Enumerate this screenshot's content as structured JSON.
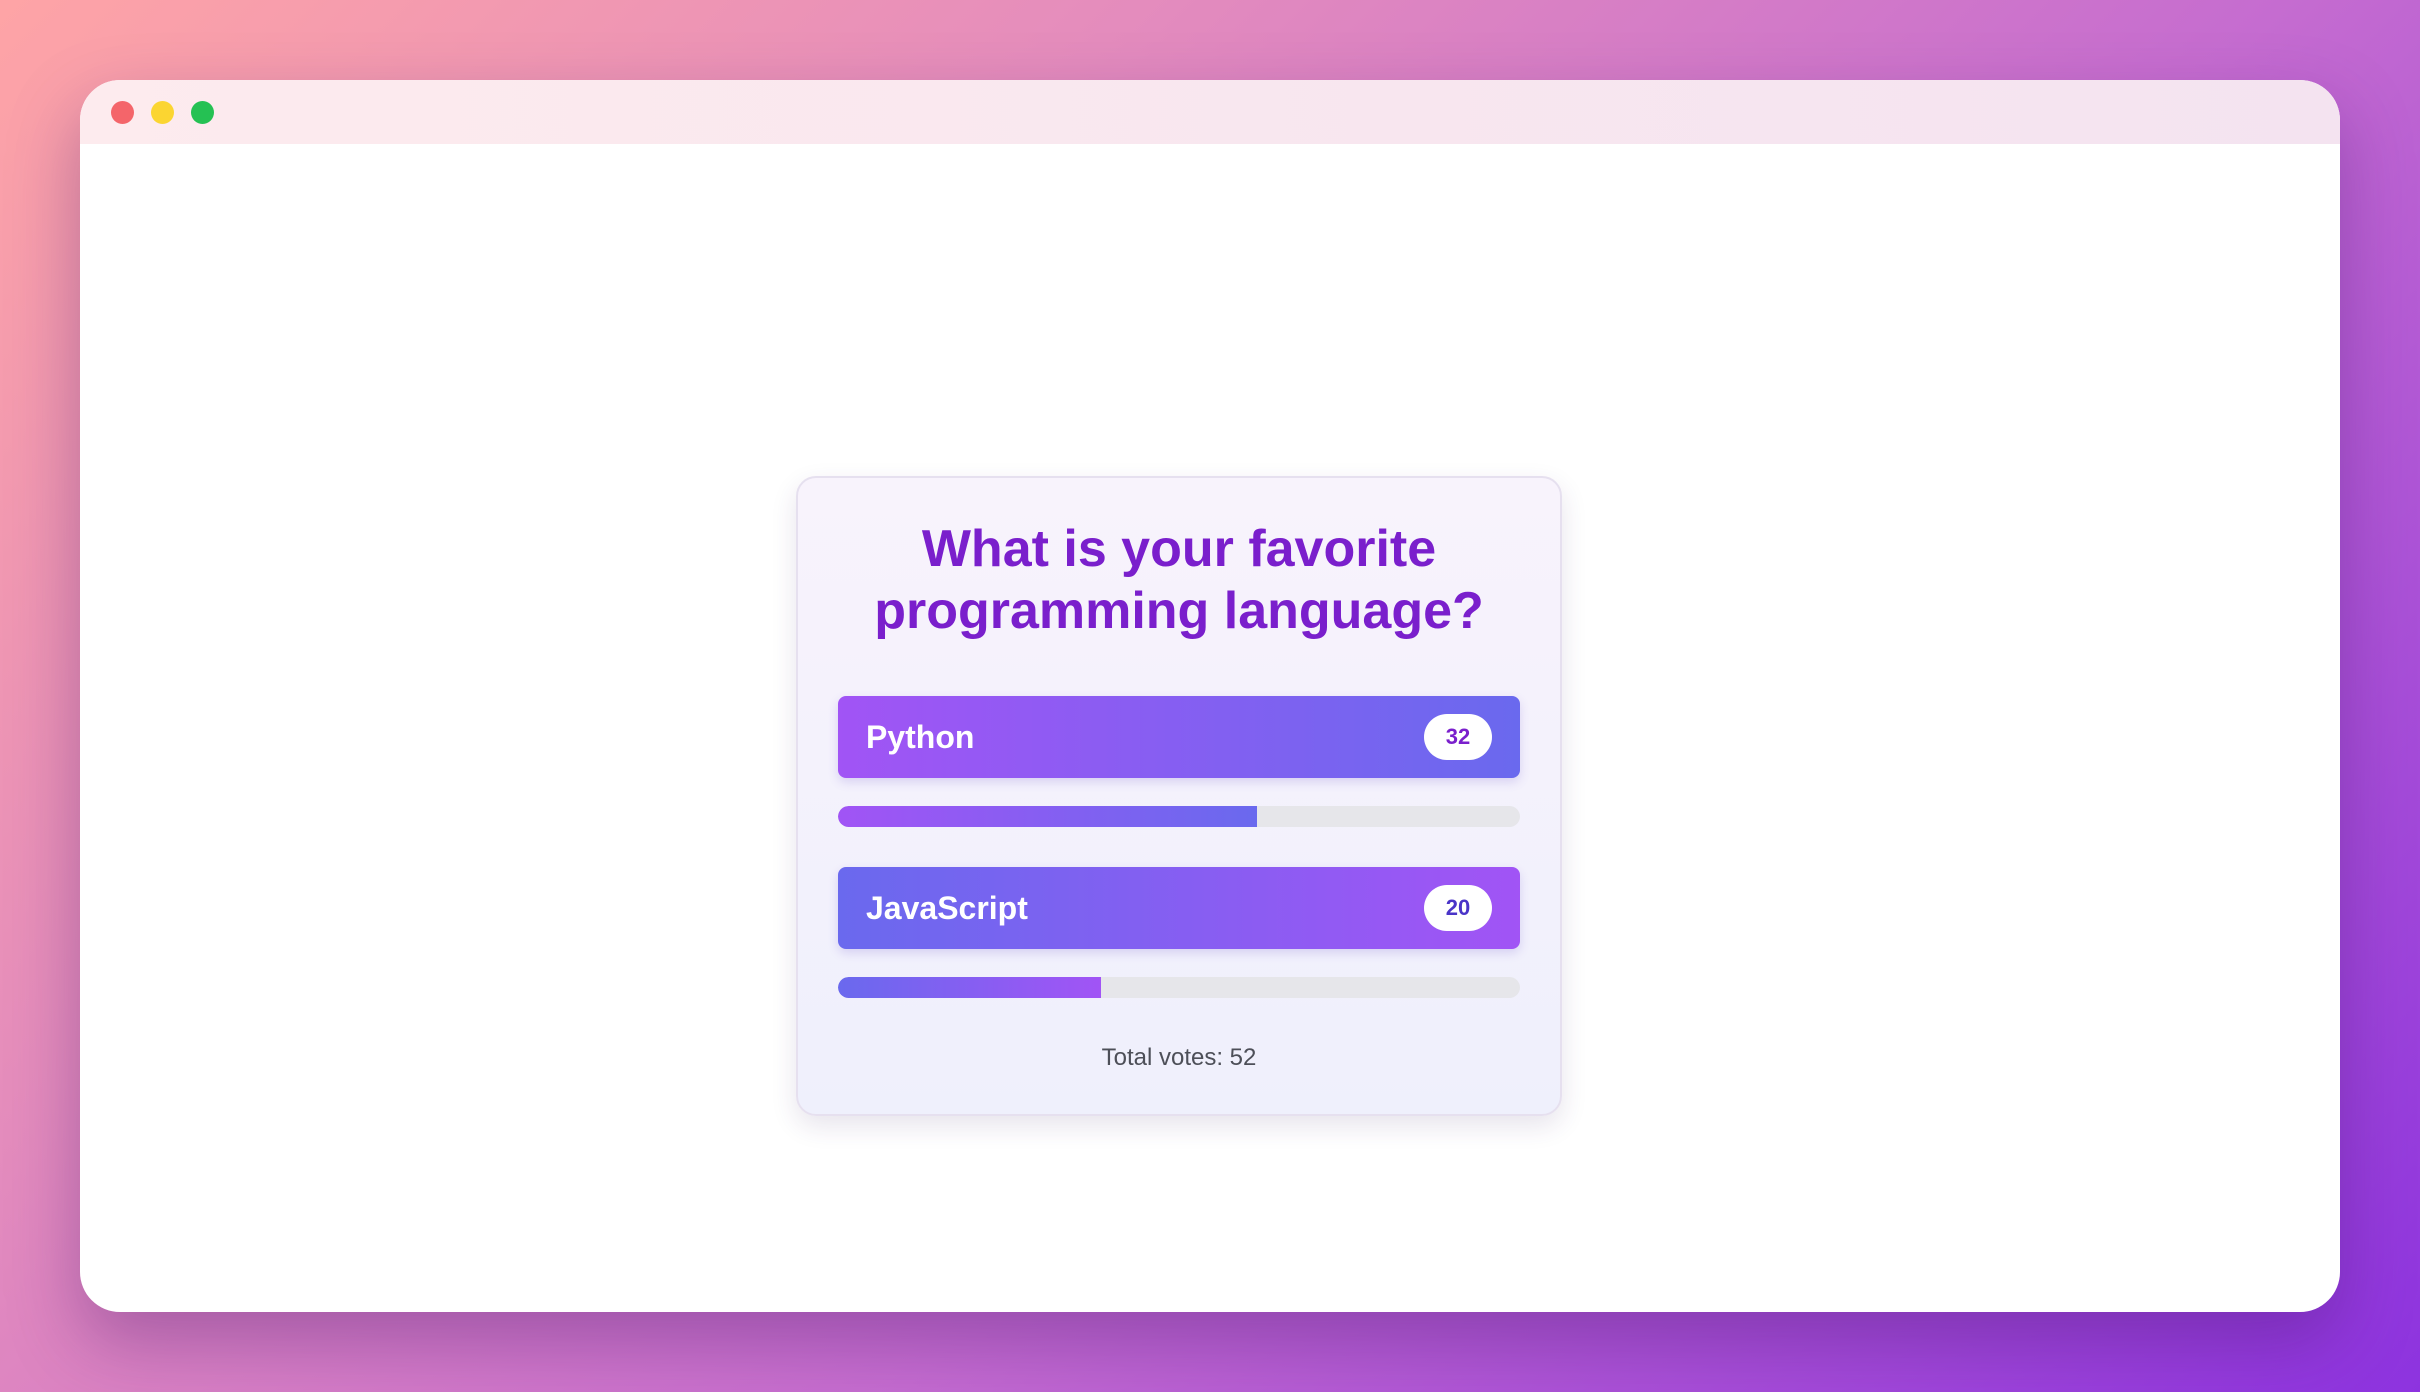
{
  "window": {
    "controls": [
      "close",
      "minimize",
      "maximize"
    ]
  },
  "poll": {
    "question": "What is your favorite programming language?",
    "options": [
      {
        "label": "Python",
        "votes": "32",
        "share": 0.615
      },
      {
        "label": "JavaScript",
        "votes": "20",
        "share": 0.385
      }
    ],
    "total": "Total votes: 52"
  },
  "colors": {
    "accent": "#7a1fcc",
    "gradient_start": "#a154f5",
    "gradient_end": "#6a69ee"
  }
}
